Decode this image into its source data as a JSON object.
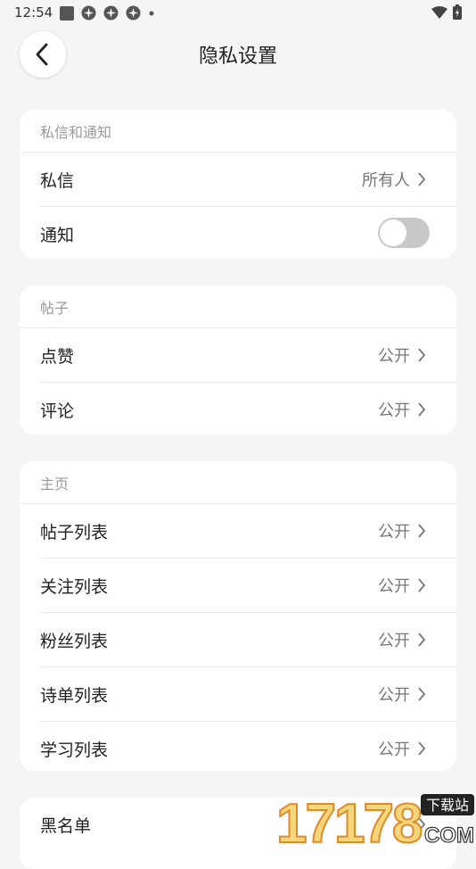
{
  "status_bar": {
    "time": "12:54"
  },
  "header": {
    "title": "隐私设置",
    "back_icon": "chevron-left-icon"
  },
  "sections": [
    {
      "title": "私信和通知",
      "rows": [
        {
          "label": "私信",
          "value": "所有人"
        },
        {
          "label": "通知",
          "toggle": false
        }
      ]
    },
    {
      "title": "帖子",
      "rows": [
        {
          "label": "点赞",
          "value": "公开"
        },
        {
          "label": "评论",
          "value": "公开"
        }
      ]
    },
    {
      "title": "主页",
      "rows": [
        {
          "label": "帖子列表",
          "value": "公开"
        },
        {
          "label": "关注列表",
          "value": "公开"
        },
        {
          "label": "粉丝列表",
          "value": "公开"
        },
        {
          "label": "诗单列表",
          "value": "公开"
        },
        {
          "label": "学习列表",
          "value": "公开"
        }
      ]
    },
    {
      "rows": [
        {
          "label": "黑名单"
        }
      ]
    }
  ],
  "watermark": {
    "number": "17178",
    "text_top": "下载站",
    "text_bottom": "COM"
  }
}
